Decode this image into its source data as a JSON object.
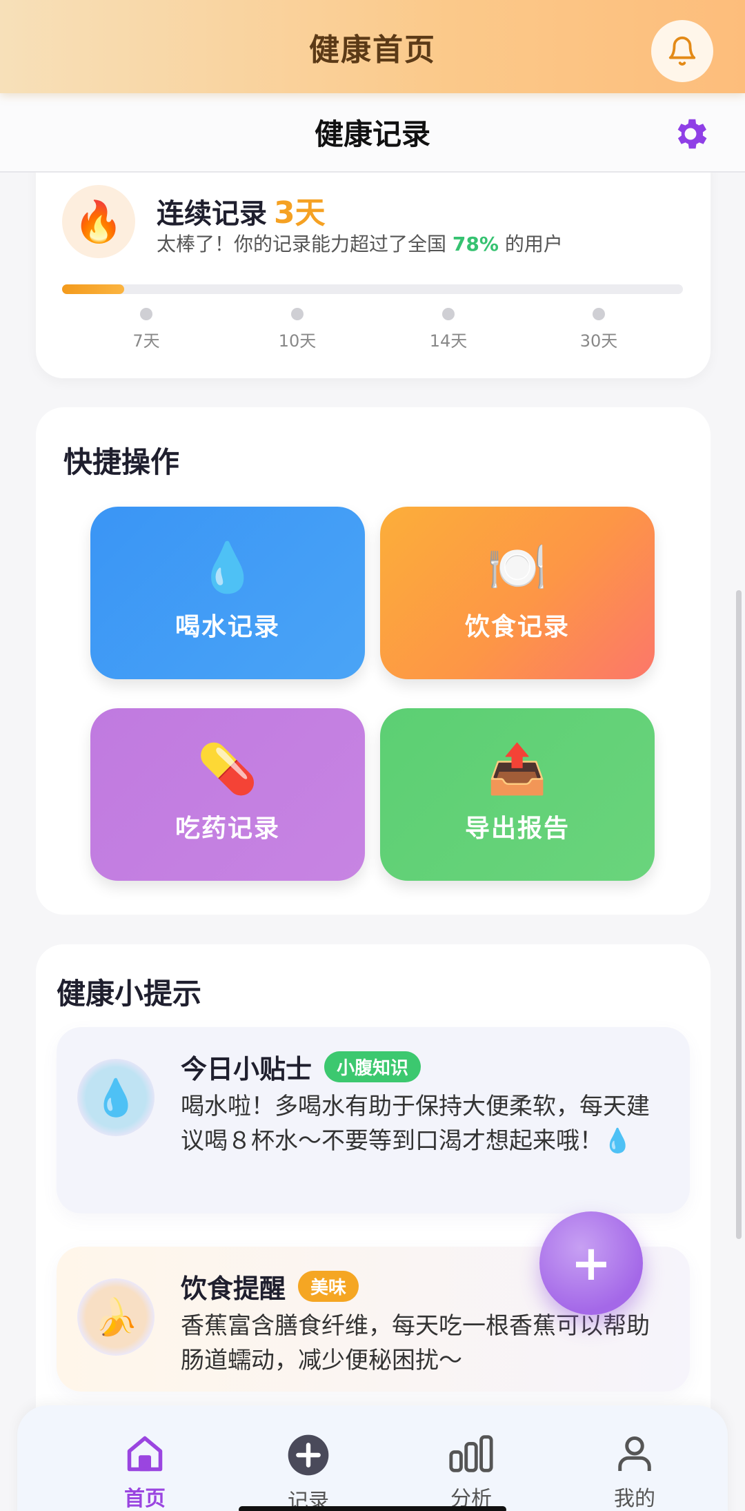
{
  "header": {
    "title": "健康首页",
    "bell_icon": "bell-icon"
  },
  "subheader": {
    "title": "健康记录",
    "settings_icon": "gear-icon"
  },
  "streak": {
    "title": "连续记录",
    "days": "3天",
    "sub_prefix": "太棒了！你的记录能力超过了全国 ",
    "percent": "78%",
    "sub_suffix": " 的用户",
    "progress_fraction": 0.1,
    "milestones": [
      "7天",
      "10天",
      "14天",
      "30天"
    ],
    "colors": {
      "accent": "#f5a123",
      "percent": "#36c271"
    }
  },
  "quick": {
    "title": "快捷操作",
    "actions": [
      {
        "icon": "💧",
        "label": "喝水记录"
      },
      {
        "icon": "🍽️",
        "label": "饮食记录"
      },
      {
        "icon": "💊",
        "label": "吃药记录"
      },
      {
        "icon": "📤",
        "label": "导出报告"
      }
    ]
  },
  "tips": {
    "title": "健康小提示",
    "items": [
      {
        "icon": "💧",
        "title": "今日小贴士",
        "tag": "小腹知识",
        "text": "喝水啦！多喝水有助于保持大便柔软，每天建议喝８杯水～不要等到口渴才想起来哦！💧"
      },
      {
        "icon": "🍌",
        "title": "饮食提醒",
        "tag": "美味",
        "text": "香蕉富含膳食纤维，每天吃一根香蕉可以帮助肠道蠕动，减少便秘困扰～"
      }
    ]
  },
  "fab": {
    "label": "+"
  },
  "nav": {
    "items": [
      {
        "label": "首页",
        "icon": "home-icon"
      },
      {
        "label": "记录",
        "icon": "plus-circle-icon"
      },
      {
        "label": "分析",
        "icon": "bar-chart-icon"
      },
      {
        "label": "我的",
        "icon": "user-icon"
      }
    ],
    "active_color": "#9a45e0"
  }
}
